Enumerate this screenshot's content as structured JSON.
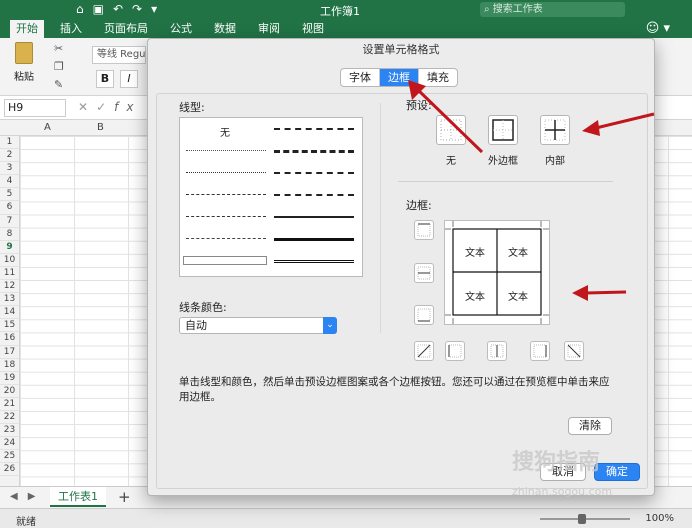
{
  "app": {
    "workbook_title": "工作簿1",
    "search_placeholder": "搜索工作表"
  },
  "ribbon_tabs": [
    "开始",
    "插入",
    "页面布局",
    "公式",
    "数据",
    "审阅",
    "视图"
  ],
  "ribbon": {
    "paste_label": "粘贴",
    "font_name": "等线 Regu",
    "bold": "B",
    "italic": "I"
  },
  "formula_bar": {
    "name_box": "H9",
    "fx": "fx"
  },
  "columns": [
    "A",
    "B"
  ],
  "rows": [
    "1",
    "2",
    "3",
    "4",
    "5",
    "6",
    "7",
    "8",
    "9",
    "10",
    "11",
    "12",
    "13",
    "14",
    "15",
    "16",
    "17",
    "18",
    "19",
    "20",
    "21",
    "22",
    "23",
    "24",
    "25",
    "26"
  ],
  "selected_row": "9",
  "sheet": {
    "tab": "工作表1",
    "add": "+"
  },
  "status": {
    "ready": "就绪",
    "zoom": "100%"
  },
  "dialog": {
    "title": "设置单元格格式",
    "tabs": [
      {
        "label": "字体",
        "active": false
      },
      {
        "label": "边框",
        "active": true
      },
      {
        "label": "填充",
        "active": false
      }
    ],
    "line_style_label": "线型:",
    "line_none": "无",
    "line_color_label": "线条颜色:",
    "line_color_value": "自动",
    "presets_label": "预设:",
    "presets": [
      "无",
      "外边框",
      "内部"
    ],
    "border_label": "边框:",
    "preview_text": [
      "文本",
      "文本",
      "文本",
      "文本"
    ],
    "description": "单击线型和颜色，然后单击预设边框图案或各个边框按钮。您还可以通过在预览框中单击来应用边框。",
    "clear_button": "清除",
    "cancel_button": "取消",
    "ok_button": "确定"
  },
  "watermark": {
    "text": "搜狗指南",
    "url": "zhinan.sogou.com"
  },
  "colors": {
    "excel_green": "#217346",
    "accent_blue": "#2c83f2",
    "arrow_red": "#c0161c"
  }
}
